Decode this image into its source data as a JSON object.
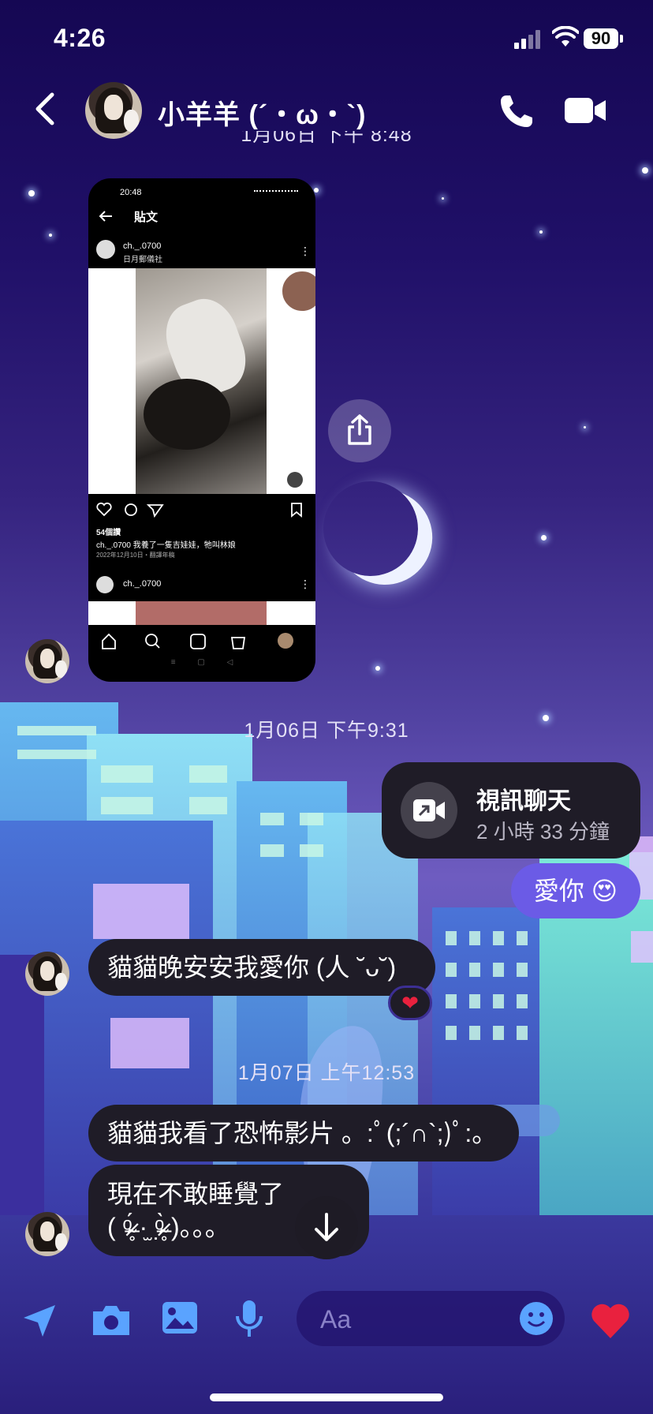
{
  "status_bar": {
    "time": "4:26",
    "battery": "90"
  },
  "header": {
    "back_icon": "chevron-left-icon",
    "contact_name": "小羊羊 (´・ω・`)",
    "call_icon": "phone-icon",
    "video_icon": "video-camera-icon"
  },
  "chat": {
    "clipped_timestamp": "1月06日 下午 8:48",
    "shared_screenshot": {
      "status_time": "20:48",
      "page_title": "貼文",
      "post_user": "ch._.0700",
      "post_subtitle": "日月郵儀社",
      "likes": "54個讚",
      "caption": "ch._.0700 我養了一隻吉娃娃，牠叫林娘",
      "caption_date": "2022年12月10日・翻譯年稿",
      "next_user": "ch._.0700"
    },
    "timestamp_1": "1月06日 下午9:31",
    "video_call": {
      "title": "視訊聊天",
      "duration": "2 小時 33 分鐘"
    },
    "out_message": "愛你 😍",
    "in_message_1": "貓貓晚安安我愛你 (人 ˘ᴗ˘)",
    "reaction": "❤",
    "timestamp_2": "1月07日 上午12:53",
    "in_message_2": "貓貓我看了恐怖影片 。:ﾟ(;´∩`;)ﾟ:。",
    "in_message_3_line1": "現在不敢睡覺了",
    "in_message_3_line2": "( ᵒ̴̶̷̥́ ·̫ ᵒ̴̶̷̣̥̀ )。。。"
  },
  "composer": {
    "placeholder": "Aa"
  },
  "bottom_icons": [
    "send-location-icon",
    "camera-icon",
    "photo-icon",
    "microphone-icon",
    "emoji-icon",
    "heart-icon"
  ],
  "colors": {
    "bubble_in": "#1f1c27",
    "bubble_out": "#6b5be6",
    "heart": "#e9213e"
  }
}
